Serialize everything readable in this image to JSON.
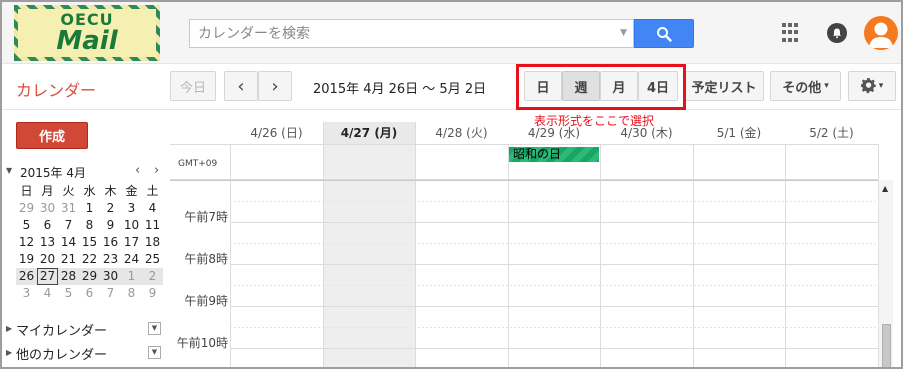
{
  "logo": {
    "top": "OECU",
    "main": "Mail"
  },
  "search": {
    "placeholder": "カレンダーを検索"
  },
  "icons": {
    "search": "search-icon",
    "apps": "apps-grid-icon",
    "notifications": "bell-icon",
    "account": "avatar-icon",
    "settings": "gear-icon"
  },
  "colors": {
    "accent": "#dd4b39",
    "create_button": "#d14836",
    "search_button": "#4285f4",
    "highlight": "#e8111b",
    "event": "#16a765",
    "avatar": "#f4791f"
  },
  "toolbar": {
    "app_title": "カレンダー",
    "today": "今日",
    "prev": "‹",
    "next": "›",
    "date_range": "2015年 4月 26日 ～ 5月 2日",
    "views": [
      "日",
      "週",
      "月",
      "4日"
    ],
    "active_view": "週",
    "agenda": "予定リスト",
    "more": "その他",
    "more_caret": "▾",
    "settings_caret": "▾"
  },
  "annotation": "表示形式をここで選択",
  "sidebar": {
    "create": "作成",
    "mini_title": "2015年 4月",
    "mini_prev": "‹",
    "mini_next": "›",
    "weekdays": [
      "日",
      "月",
      "火",
      "水",
      "木",
      "金",
      "土"
    ],
    "weeks": [
      [
        "29",
        "30",
        "31",
        "1",
        "2",
        "3",
        "4"
      ],
      [
        "5",
        "6",
        "7",
        "8",
        "9",
        "10",
        "11"
      ],
      [
        "12",
        "13",
        "14",
        "15",
        "16",
        "17",
        "18"
      ],
      [
        "19",
        "20",
        "21",
        "22",
        "23",
        "24",
        "25"
      ],
      [
        "26",
        "27",
        "28",
        "29",
        "30",
        "1",
        "2"
      ],
      [
        "3",
        "4",
        "5",
        "6",
        "7",
        "8",
        "9"
      ]
    ],
    "today_date": "27",
    "my_calendars": "マイカレンダー",
    "other_calendars": "他のカレンダー"
  },
  "grid": {
    "timezone": "GMT+09",
    "days": [
      "4/26 (日)",
      "4/27 (月)",
      "4/28 (火)",
      "4/29 (水)",
      "4/30 (木)",
      "5/1 (金)",
      "5/2 (土)"
    ],
    "today_index": 1,
    "allday_event": {
      "title": "昭和の日",
      "day_index": 3
    },
    "hours": [
      "午前7時",
      "午前8時",
      "午前9時",
      "午前10時"
    ]
  }
}
